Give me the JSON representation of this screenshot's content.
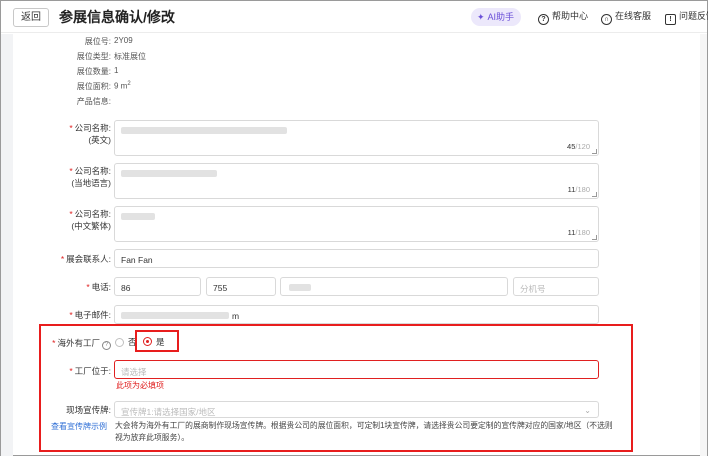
{
  "header": {
    "back_label": "返回",
    "title": "参展信息确认/修改",
    "ai_label": "AI助手",
    "help_center": "帮助中心",
    "online_service": "在线客服",
    "feedback": "问题反馈"
  },
  "booth_info": {
    "booth_no_label": "展位号:",
    "booth_no": "2Y09",
    "booth_type_label": "展位类型:",
    "booth_type": "标准展位",
    "booth_count_label": "展位数量:",
    "booth_count": "1",
    "booth_area_label": "展位面积:",
    "booth_area": "9 m",
    "booth_area_sup": "2",
    "product_info_label": "产品信息:"
  },
  "form": {
    "company_en_label": "公司名称:",
    "company_en_sub": "(英文)",
    "company_en_count": "45",
    "company_en_max": "/120",
    "company_local_label": "公司名称:",
    "company_local_sub": "(当地语言)",
    "company_local_count": "11",
    "company_local_max": "/180",
    "company_tc_label": "公司名称:",
    "company_tc_sub": "(中文繁体)",
    "company_tc_count": "11",
    "company_tc_max": "/180",
    "contact_label": "展会联系人:",
    "contact_value": "Fan Fan",
    "phone_label": "电话:",
    "phone_country": "86",
    "phone_area": "755",
    "phone_ext_placeholder": "分机号",
    "email_label": "电子邮件:",
    "email_tail": "m",
    "overseas_label": "海外有工厂",
    "help_glyph": "?",
    "option_no": "否",
    "option_yes": "是",
    "factory_label": "工厂位于:",
    "factory_placeholder": "请选择",
    "factory_error": "此项为必填项",
    "banner_label": "现场宣传牌:",
    "banner_placeholder": "宣传牌1:请选择国家/地区",
    "banner_example_link": "查看宣传牌示例",
    "banner_desc": "大会将为海外有工厂的展商制作现场宣传牌。根据贵公司的展位面积，可定制1块宣传牌，请选择贵公司要定制的宣传牌对应的国家/地区（不选则视为放弃此项服务）。",
    "required_mark": "*"
  },
  "colors": {
    "required": "#e02020",
    "highlight": "#e81d1d",
    "link": "#2f6fd6",
    "ai_bg": "#ece8fb",
    "ai_text": "#6a4fd8"
  }
}
